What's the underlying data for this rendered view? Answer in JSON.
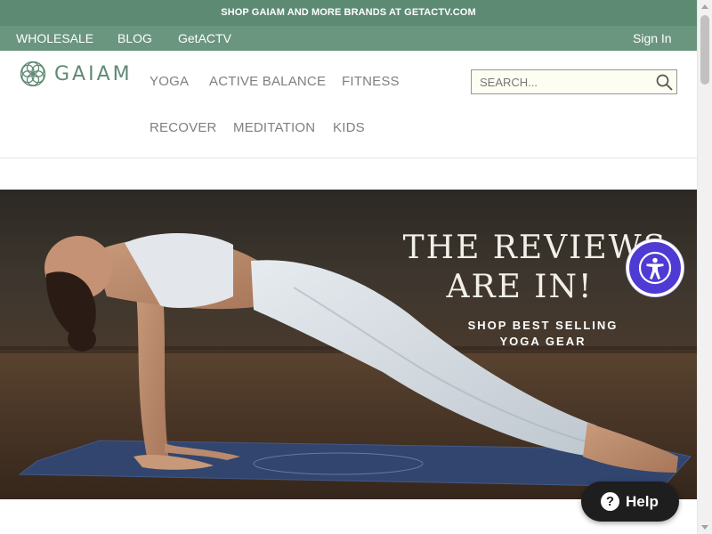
{
  "promo_bar": {
    "text": "SHOP GAIAM AND MORE BRANDS AT GETACTV.COM"
  },
  "utility_nav": {
    "items": [
      {
        "label": "WHOLESALE"
      },
      {
        "label": "BLOG"
      },
      {
        "label": "GetACTV"
      }
    ],
    "sign_in": "Sign In"
  },
  "header": {
    "logo_text": "GAIAM",
    "nav": [
      {
        "label": "YOGA"
      },
      {
        "label": "ACTIVE BALANCE"
      },
      {
        "label": "FITNESS"
      },
      {
        "label": "RECOVER"
      },
      {
        "label": "MEDITATION"
      },
      {
        "label": "KIDS"
      }
    ],
    "search": {
      "placeholder": "SEARCH...",
      "value": ""
    }
  },
  "hero": {
    "headline_line1": "THE REVIEWS",
    "headline_line2": "ARE IN!",
    "cta_line1": "SHOP BEST SELLING",
    "cta_line2": "YOGA GEAR"
  },
  "widgets": {
    "help_label": "Help",
    "help_icon_glyph": "?",
    "accessibility_icon": "accessibility-person-icon"
  },
  "colors": {
    "promo_bar": "#5d8a73",
    "utility_nav": "#6a957f",
    "brand_green": "#5f8a74",
    "accessibility_button": "#4f3bd3",
    "help_button": "#1e1e1e"
  }
}
